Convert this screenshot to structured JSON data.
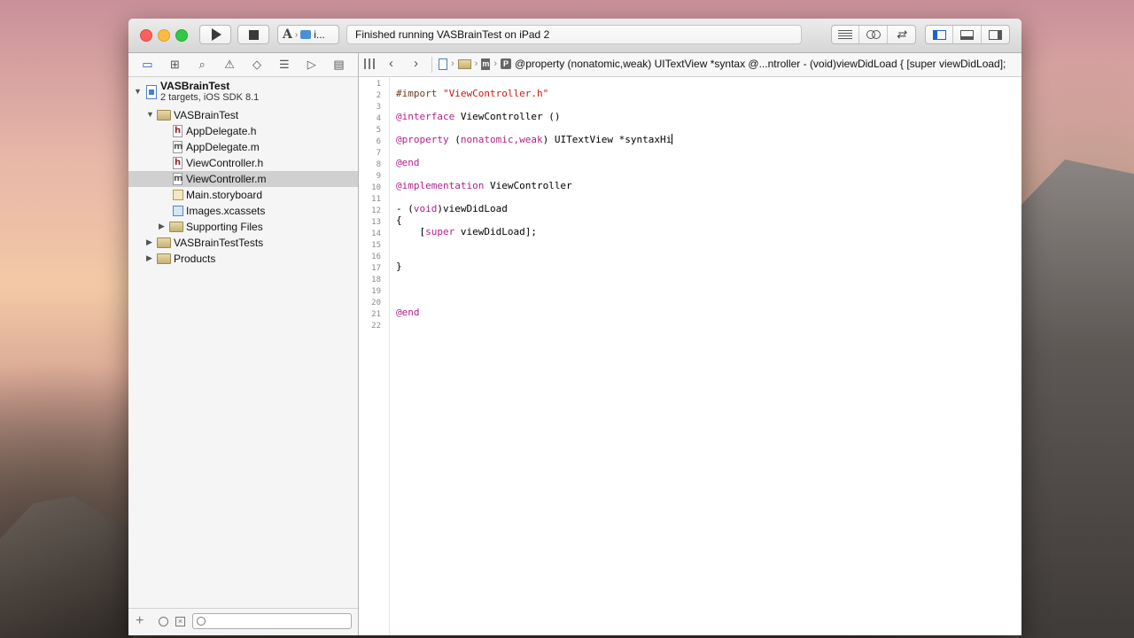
{
  "toolbar": {
    "status": "Finished running VASBrainTest on iPad 2",
    "scheme_text": "i..."
  },
  "navigator": {
    "project": {
      "name": "VASBrainTest",
      "subtitle": "2 targets, iOS SDK 8.1"
    },
    "items": [
      {
        "label": "VASBrainTest",
        "kind": "group",
        "expanded": true
      },
      {
        "label": "AppDelegate.h",
        "kind": "h"
      },
      {
        "label": "AppDelegate.m",
        "kind": "m"
      },
      {
        "label": "ViewController.h",
        "kind": "h"
      },
      {
        "label": "ViewController.m",
        "kind": "m",
        "selected": true
      },
      {
        "label": "Main.storyboard",
        "kind": "storyboard"
      },
      {
        "label": "Images.xcassets",
        "kind": "xcassets"
      },
      {
        "label": "Supporting Files",
        "kind": "group",
        "expanded": false
      },
      {
        "label": "VASBrainTestTests",
        "kind": "group",
        "expanded": false
      },
      {
        "label": "Products",
        "kind": "group",
        "expanded": false
      }
    ]
  },
  "jumpbar": {
    "text": "@property (nonatomic,weak) UITextView *syntax @...ntroller - (void)viewDidLoad { [super viewDidLoad];"
  },
  "editor": {
    "line_numbers": [
      "1",
      "2",
      "3",
      "4",
      "5",
      "6",
      "7",
      "8",
      "9",
      "10",
      "11",
      "12",
      "13",
      "14",
      "15",
      "16",
      "17",
      "18",
      "19",
      "20",
      "21",
      "22"
    ],
    "code": {
      "l2_kw": "#import",
      "l2_str": "\"ViewController.h\"",
      "l4_kw": "@interface",
      "l4_rest": " ViewController ()",
      "l6_kw": "@property",
      "l6_p1": " (",
      "l6_attrs": "nonatomic,weak",
      "l6_p2": ") UITextView *syntaxHi",
      "l8_kw": "@end",
      "l10_kw": "@implementation",
      "l10_rest": " ViewController",
      "l12_a": "- (",
      "l12_void": "void",
      "l12_b": ")viewDidLoad",
      "l13": "{",
      "l14_a": "    [",
      "l14_super": "super",
      "l14_b": " viewDidLoad",
      "l14_c": "];",
      "l17": "}",
      "l21_kw": "@end"
    }
  },
  "colors": {
    "keyword": "#b0208e",
    "string": "#c41a16",
    "accent": "#1e5fcf"
  }
}
